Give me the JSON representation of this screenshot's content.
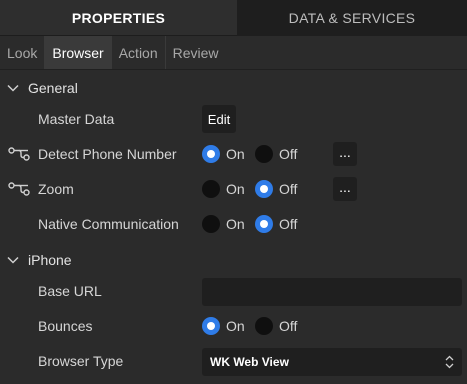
{
  "top_tabs": {
    "properties": "PROPERTIES",
    "data_services": "DATA & SERVICES"
  },
  "sub_tabs": [
    "Look",
    "Browser",
    "Action",
    "Review"
  ],
  "active_sub_tab": "Browser",
  "general": {
    "title": "General",
    "master_data": {
      "label": "Master Data",
      "button": "Edit"
    },
    "detect_phone": {
      "label": "Detect Phone Number",
      "on": "On",
      "off": "Off",
      "selected": "On",
      "more": "..."
    },
    "zoom": {
      "label": "Zoom",
      "on": "On",
      "off": "Off",
      "selected": "Off",
      "more": "..."
    },
    "native_comm": {
      "label": "Native Communication",
      "on": "On",
      "off": "Off",
      "selected": "Off"
    }
  },
  "iphone": {
    "title": "iPhone",
    "base_url": {
      "label": "Base URL",
      "value": ""
    },
    "bounces": {
      "label": "Bounces",
      "on": "On",
      "off": "Off",
      "selected": "On"
    },
    "browser_type": {
      "label": "Browser Type",
      "value": "WK Web View"
    }
  },
  "colors": {
    "accent": "#2f7ce8",
    "panel_bg": "#2b2b2b",
    "control_bg": "#1f1f1f"
  }
}
